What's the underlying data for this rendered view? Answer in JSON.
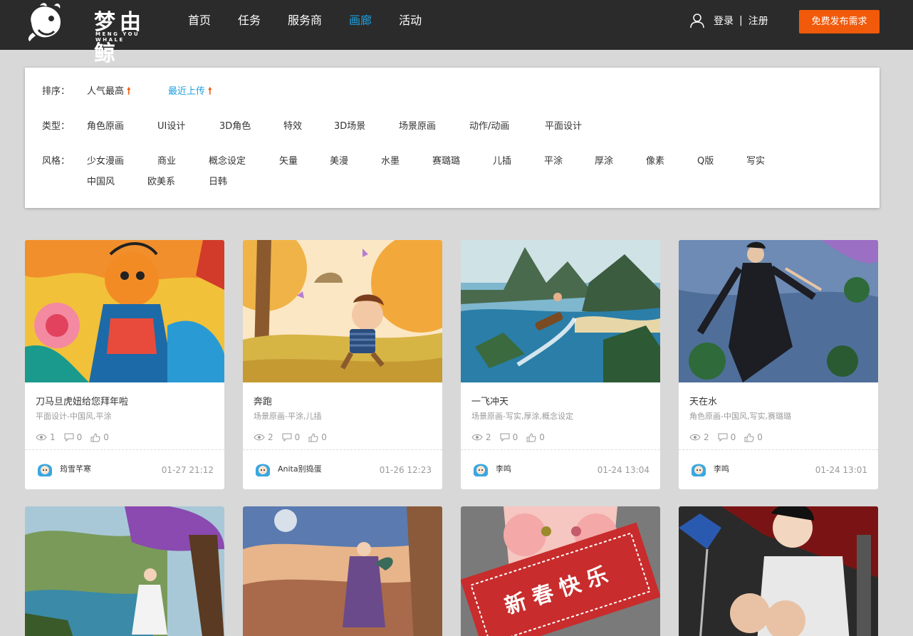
{
  "header": {
    "logo_text": "梦由鲸",
    "logo_sub": "MENG YOU WHALE",
    "nav": [
      {
        "label": "首页",
        "active": false
      },
      {
        "label": "任务",
        "active": false
      },
      {
        "label": "服务商",
        "active": false
      },
      {
        "label": "画廊",
        "active": true
      },
      {
        "label": "活动",
        "active": false
      }
    ],
    "login": "登录",
    "separator": "|",
    "register": "注册",
    "publish": "免费发布需求"
  },
  "filters": {
    "sort_label": "排序：",
    "sort_options": [
      "人气最高",
      "最近上传"
    ],
    "sort_arrow": "🠕",
    "type_label": "类型：",
    "types": [
      "角色原画",
      "UI设计",
      "3D角色",
      "特效",
      "3D场景",
      "场景原画",
      "动作/动画",
      "平面设计"
    ],
    "style_label": "风格：",
    "styles": [
      "少女漫画",
      "商业",
      "概念设定",
      "矢量",
      "美漫",
      "水墨",
      "赛璐璐",
      "儿插",
      "平涂",
      "厚涂",
      "像素",
      "Q版",
      "写实",
      "中国风",
      "欧美系",
      "日韩"
    ]
  },
  "cards": [
    {
      "title": "刀马旦虎妞给您拜年啦",
      "tags": "平面设计-中国风,平涂",
      "views": "1",
      "comments": "0",
      "likes": "0",
      "author": "筠雪芊寒",
      "date": "01-27 21:12"
    },
    {
      "title": "奔跑",
      "tags": "场景原画-平涂,儿插",
      "views": "2",
      "comments": "0",
      "likes": "0",
      "author": "Anita别捣蛋",
      "date": "01-26 12:23"
    },
    {
      "title": "一飞冲天",
      "tags": "场景原画-写实,厚涂,概念设定",
      "views": "2",
      "comments": "0",
      "likes": "0",
      "author": "李鸣",
      "date": "01-24 13:04"
    },
    {
      "title": "天在水",
      "tags": "角色原画-中国风,写实,赛璐璐",
      "views": "2",
      "comments": "0",
      "likes": "0",
      "author": "李鸣",
      "date": "01-24 13:01"
    }
  ],
  "banner_text": "新春快乐"
}
